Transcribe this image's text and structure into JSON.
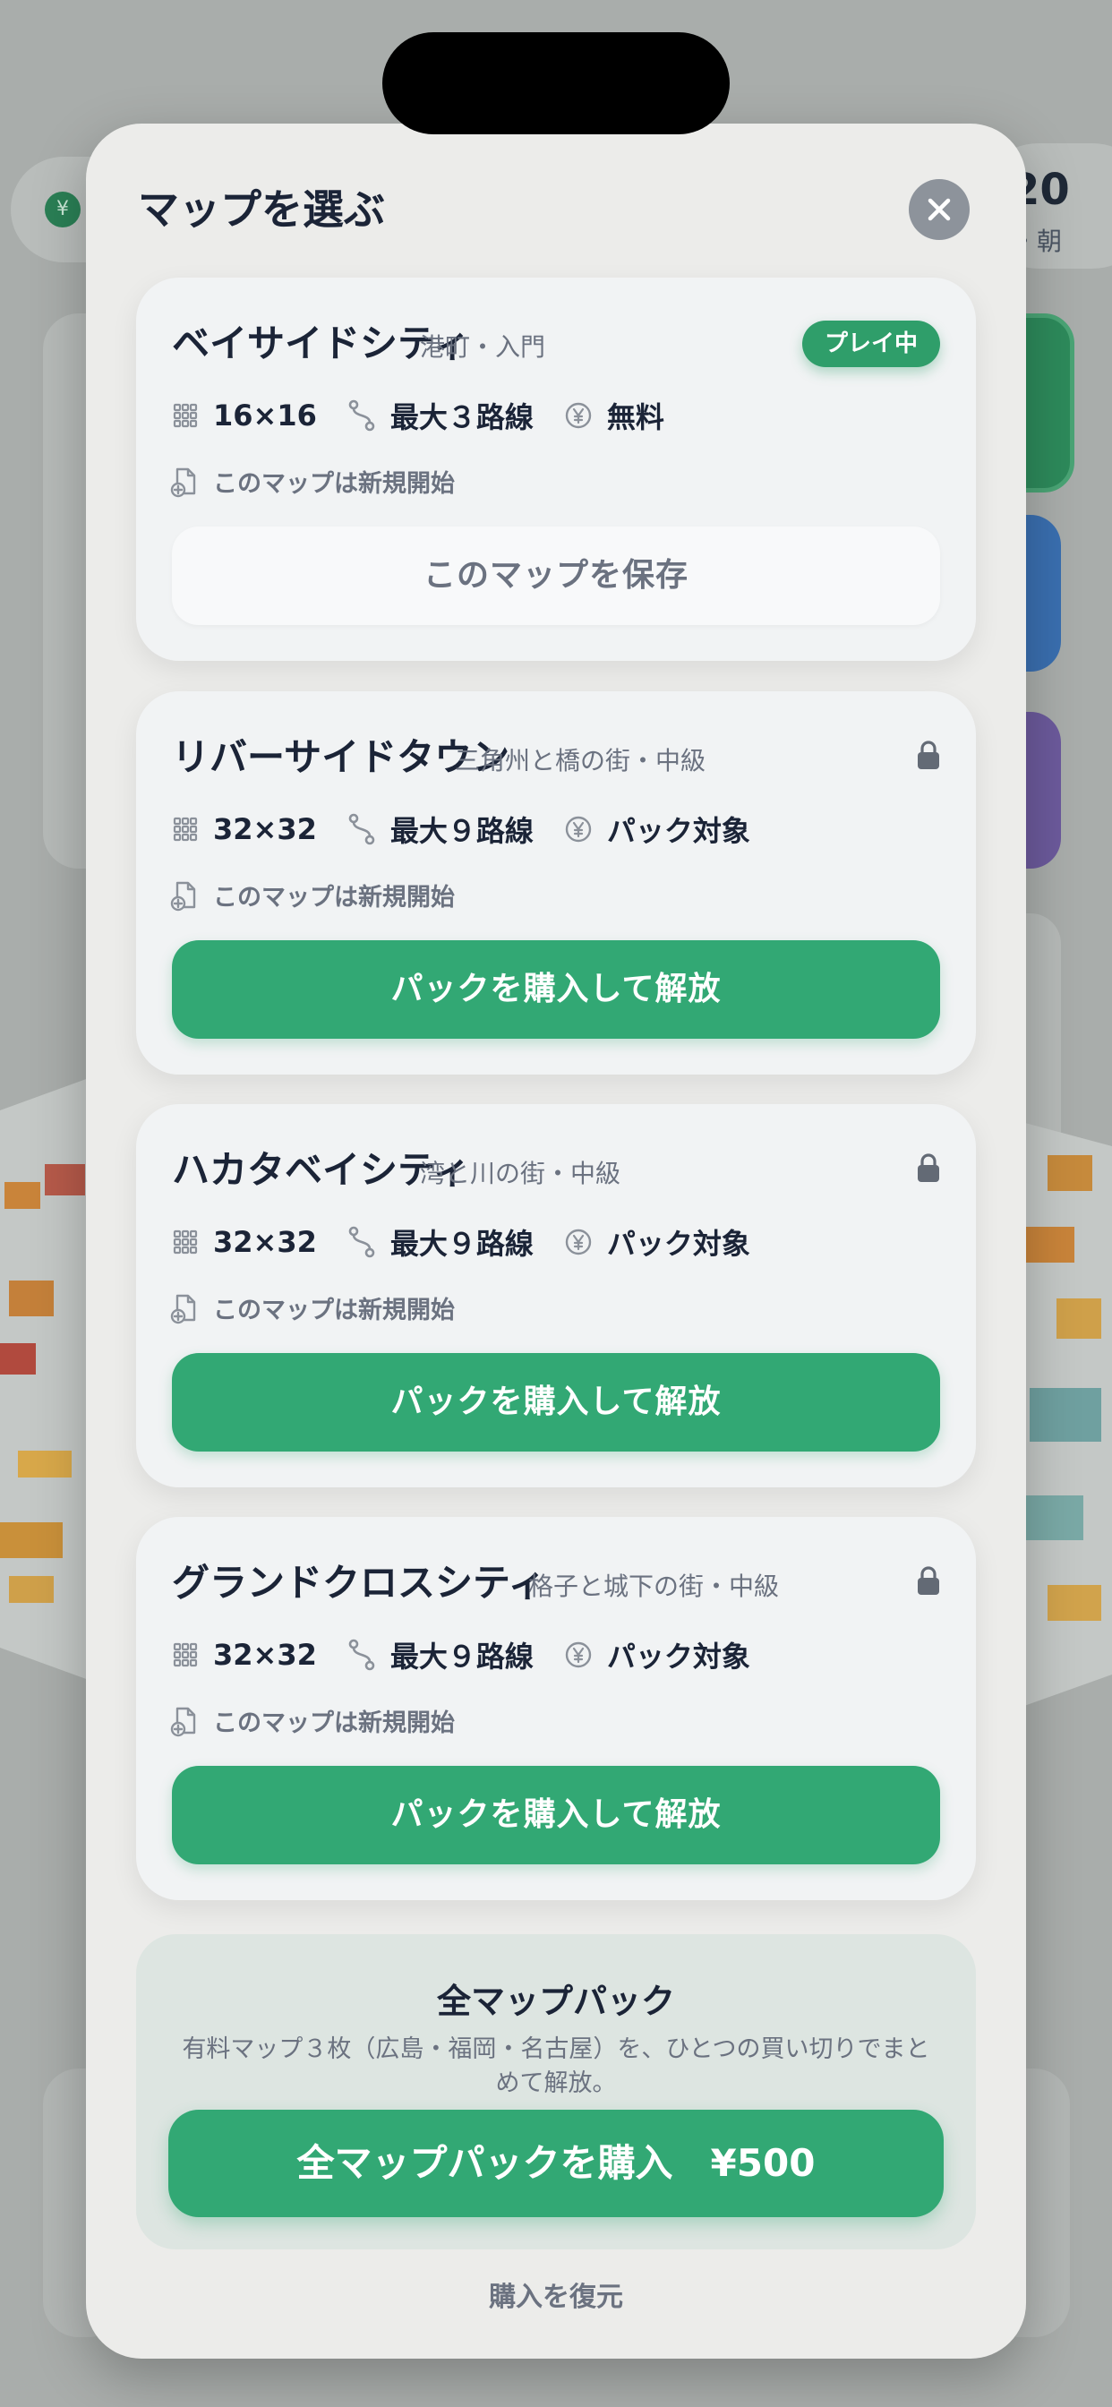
{
  "background": {
    "currency_symbol": "¥",
    "score": "20",
    "score_sub": "・朝"
  },
  "modal": {
    "title": "マップを選ぶ",
    "close_icon": "close-icon"
  },
  "maps": [
    {
      "name": "ベイサイドシティ",
      "subtitle": "港町・入門",
      "status": "playing",
      "status_label": "プレイ中",
      "size": "16×16",
      "lines": "最大３路線",
      "price": "無料",
      "save_state": "このマップは新規開始",
      "action_label": "このマップを保存",
      "action_type": "save"
    },
    {
      "name": "リバーサイドタウン",
      "subtitle": "三角州と橋の街・中級",
      "status": "locked",
      "size": "32×32",
      "lines": "最大９路線",
      "price": "パック対象",
      "save_state": "このマップは新規開始",
      "action_label": "パックを購入して解放",
      "action_type": "buy"
    },
    {
      "name": "ハカタベイシティ",
      "subtitle": "湾と川の街・中級",
      "status": "locked",
      "size": "32×32",
      "lines": "最大９路線",
      "price": "パック対象",
      "save_state": "このマップは新規開始",
      "action_label": "パックを購入して解放",
      "action_type": "buy"
    },
    {
      "name": "グランドクロスシティ",
      "subtitle": "格子と城下の街・中級",
      "status": "locked",
      "size": "32×32",
      "lines": "最大９路線",
      "price": "パック対象",
      "save_state": "このマップは新規開始",
      "action_label": "パックを購入して解放",
      "action_type": "buy"
    }
  ],
  "pack": {
    "title": "全マップパック",
    "description": "有料マップ３枚（広島・福岡・名古屋）を、ひとつの買い切りでまとめて解放。",
    "buy_label": "全マップパックを購入　¥500"
  },
  "restore_label": "購入を復元",
  "colors": {
    "accent_green": "#32a874",
    "text_dark": "#1b2437",
    "text_muted": "#6b7280",
    "card_bg": "#f1f3f4",
    "modal_bg": "#ececea"
  }
}
